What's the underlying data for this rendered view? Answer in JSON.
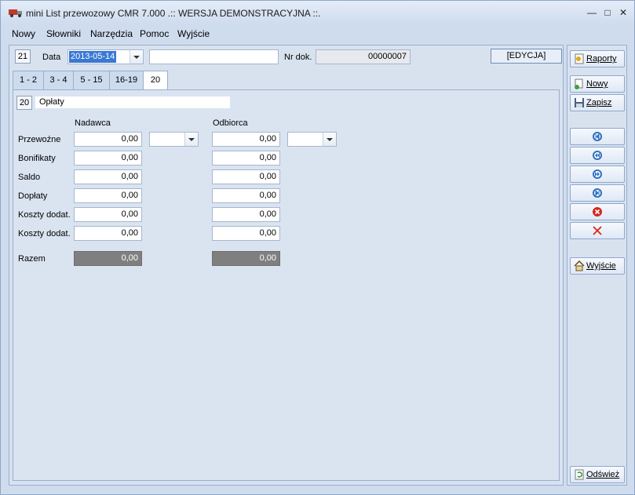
{
  "window": {
    "title": "mini List przewozowy CMR 7.000 .:: WERSJA DEMONSTRACYJNA ::.",
    "min": "—",
    "restore": "□",
    "close": "✕"
  },
  "menu": [
    "Nowy",
    "Słowniki",
    "Narzędzia",
    "Pomoc",
    "Wyjście"
  ],
  "header": {
    "num": "21",
    "date_label": "Data",
    "date_value": "2013-05-14",
    "text_value": "",
    "nrdok_label": "Nr dok.",
    "nrdok_value": "00000007",
    "mode_badge": "[EDYCJA]"
  },
  "tabs": [
    {
      "label": "1 - 2",
      "active": false
    },
    {
      "label": "3 - 4",
      "active": false
    },
    {
      "label": "5 - 15",
      "active": false
    },
    {
      "label": "16-19",
      "active": false
    },
    {
      "label": "20",
      "active": true
    }
  ],
  "section": {
    "num": "20",
    "title": "Opłaty"
  },
  "columns": {
    "nadawca": "Nadawca",
    "odbiorca": "Odbiorca"
  },
  "rows": [
    {
      "label": "Przewoźne",
      "nadawca": "0,00",
      "odbiorca": "0,00",
      "currency_nad": "",
      "currency_odb": ""
    },
    {
      "label": "Bonifikaty",
      "nadawca": "0,00",
      "odbiorca": "0,00"
    },
    {
      "label": "Saldo",
      "nadawca": "0,00",
      "odbiorca": "0,00"
    },
    {
      "label": "Dopłaty",
      "nadawca": "0,00",
      "odbiorca": "0,00"
    },
    {
      "label": "Koszty dodat.",
      "nadawca": "0,00",
      "odbiorca": "0,00"
    },
    {
      "label": "Koszty dodat.",
      "nadawca": "0,00",
      "odbiorca": "0,00"
    }
  ],
  "razem": {
    "label": "Razem",
    "nadawca": "0,00",
    "odbiorca": "0,00"
  },
  "side": {
    "raporty": "Raporty",
    "nowy": "Nowy",
    "zapisz": "Zapisz",
    "wyjscie": "Wyjście",
    "odswiez": "Odśwież"
  },
  "colors": {
    "accent": "#3a78d4",
    "delete": "#d8261b"
  }
}
